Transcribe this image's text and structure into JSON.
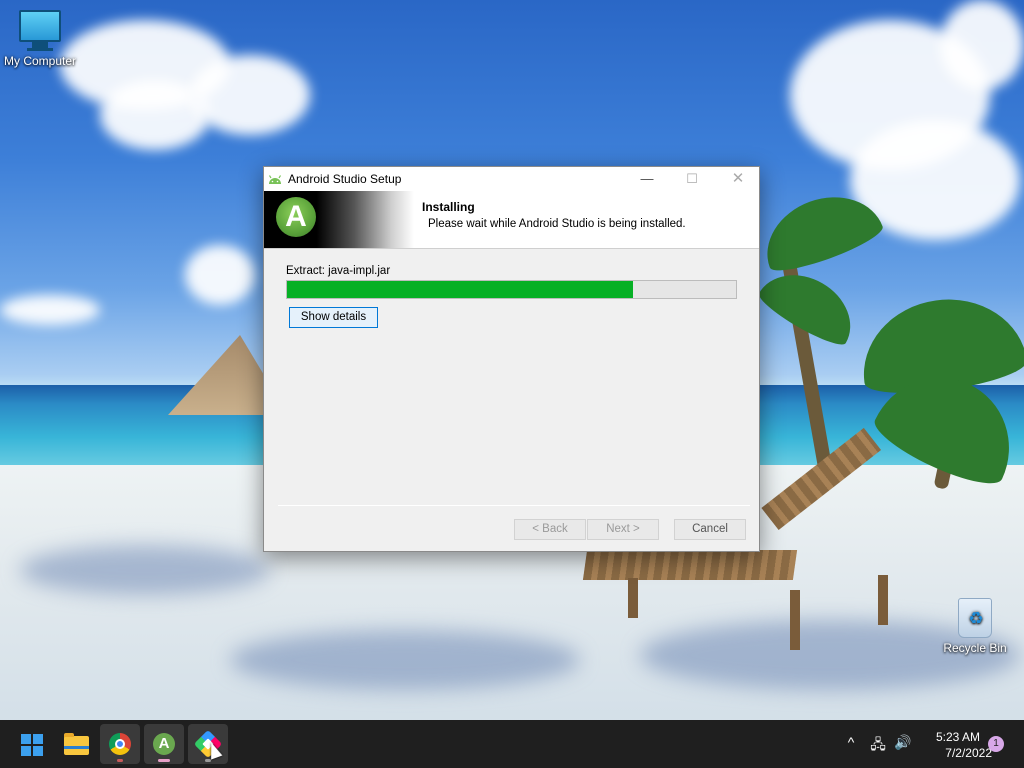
{
  "desktop": {
    "icons": {
      "my_computer": "My Computer",
      "recycle_bin": "Recycle Bin"
    }
  },
  "dialog": {
    "title": "Android Studio Setup",
    "header_title": "Installing",
    "header_subtitle": "Please wait while Android Studio is being installed.",
    "extract_text": "Extract: java-impl.jar",
    "progress_fraction": 0.77,
    "progress_color": "#06b025",
    "show_details_label": "Show details",
    "back_label": "< Back",
    "next_label": "Next >",
    "cancel_label": "Cancel",
    "window_buttons": {
      "minimize": "—",
      "maximize": "☐",
      "close": "✕"
    }
  },
  "taskbar": {
    "apps": [
      "windows-start-icon",
      "file-explorer-icon",
      "chrome-icon",
      "android-studio-icon",
      "app-gem-icon"
    ],
    "tray": {
      "chevron": "^",
      "network": "🖧",
      "volume": "🔊"
    },
    "clock": {
      "time": "5:23 AM",
      "date": "7/2/2022"
    },
    "notification_count": "1"
  }
}
